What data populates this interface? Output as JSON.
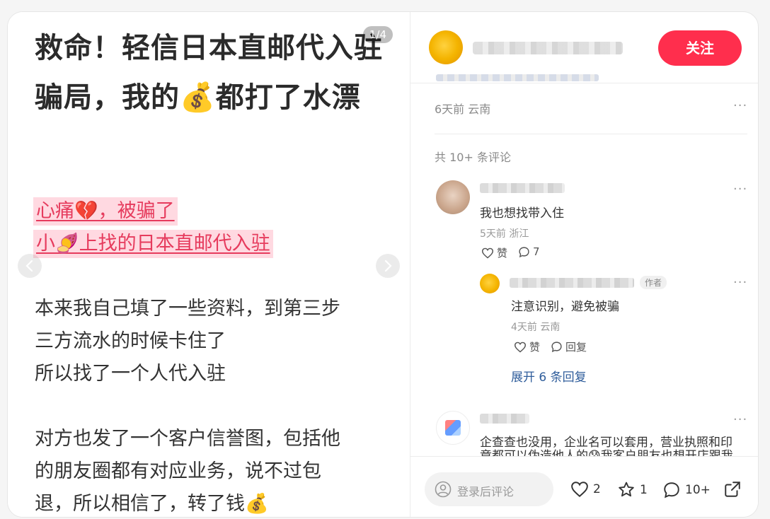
{
  "post": {
    "title": "救命！轻信日本直邮代入驻骗局，我的💰都打了水漂",
    "page_indicator": "1/4",
    "highlight_lines": [
      "心痛💔，被骗了",
      "小🍠上找的日本直邮代入驻"
    ],
    "body_paragraph_1": [
      "本来我自己填了一些资料，到第三步",
      "三方流水的时候卡住了",
      "所以找了一个人代入驻"
    ],
    "body_paragraph_2": [
      "对方也发了一个客户信誉图，包括他",
      "的朋友圈都有对应业务，说不过包",
      "退，所以相信了，转了钱💰"
    ]
  },
  "header": {
    "follow_label": "关注"
  },
  "post_meta": {
    "time_location": "6天前 云南",
    "more": "···"
  },
  "comments_header": "共 10+ 条评论",
  "comments": [
    {
      "text": "我也想找带入住",
      "meta": "5天前 浙江",
      "like_label": "赞",
      "reply_count": "7",
      "more": "···",
      "replies": [
        {
          "author_tag": "作者",
          "text": "注意识别，避免被骗",
          "meta": "4天前 云南",
          "like_label": "赞",
          "reply_label": "回复",
          "more": "···"
        }
      ],
      "expand_label": "展开 6 条回复"
    },
    {
      "text_lines": [
        "企查查也没用，企业名可以套用，营业执照和印",
        "章都可以伪造他人的😰我客户朋友也想开店跟我"
      ],
      "more": "···"
    }
  ],
  "footer": {
    "comment_placeholder": "登录后评论",
    "likes": "2",
    "stars": "1",
    "comments": "10+"
  },
  "icons": [
    "chevron-left-icon",
    "chevron-right-icon",
    "heart-icon",
    "star-icon",
    "comment-icon",
    "share-icon",
    "user-icon"
  ],
  "colors": {
    "accent": "#ff2e4d",
    "highlight_text": "#e63b5d",
    "highlight_bg": "#ffd9e1",
    "link": "#2f5d9b"
  }
}
